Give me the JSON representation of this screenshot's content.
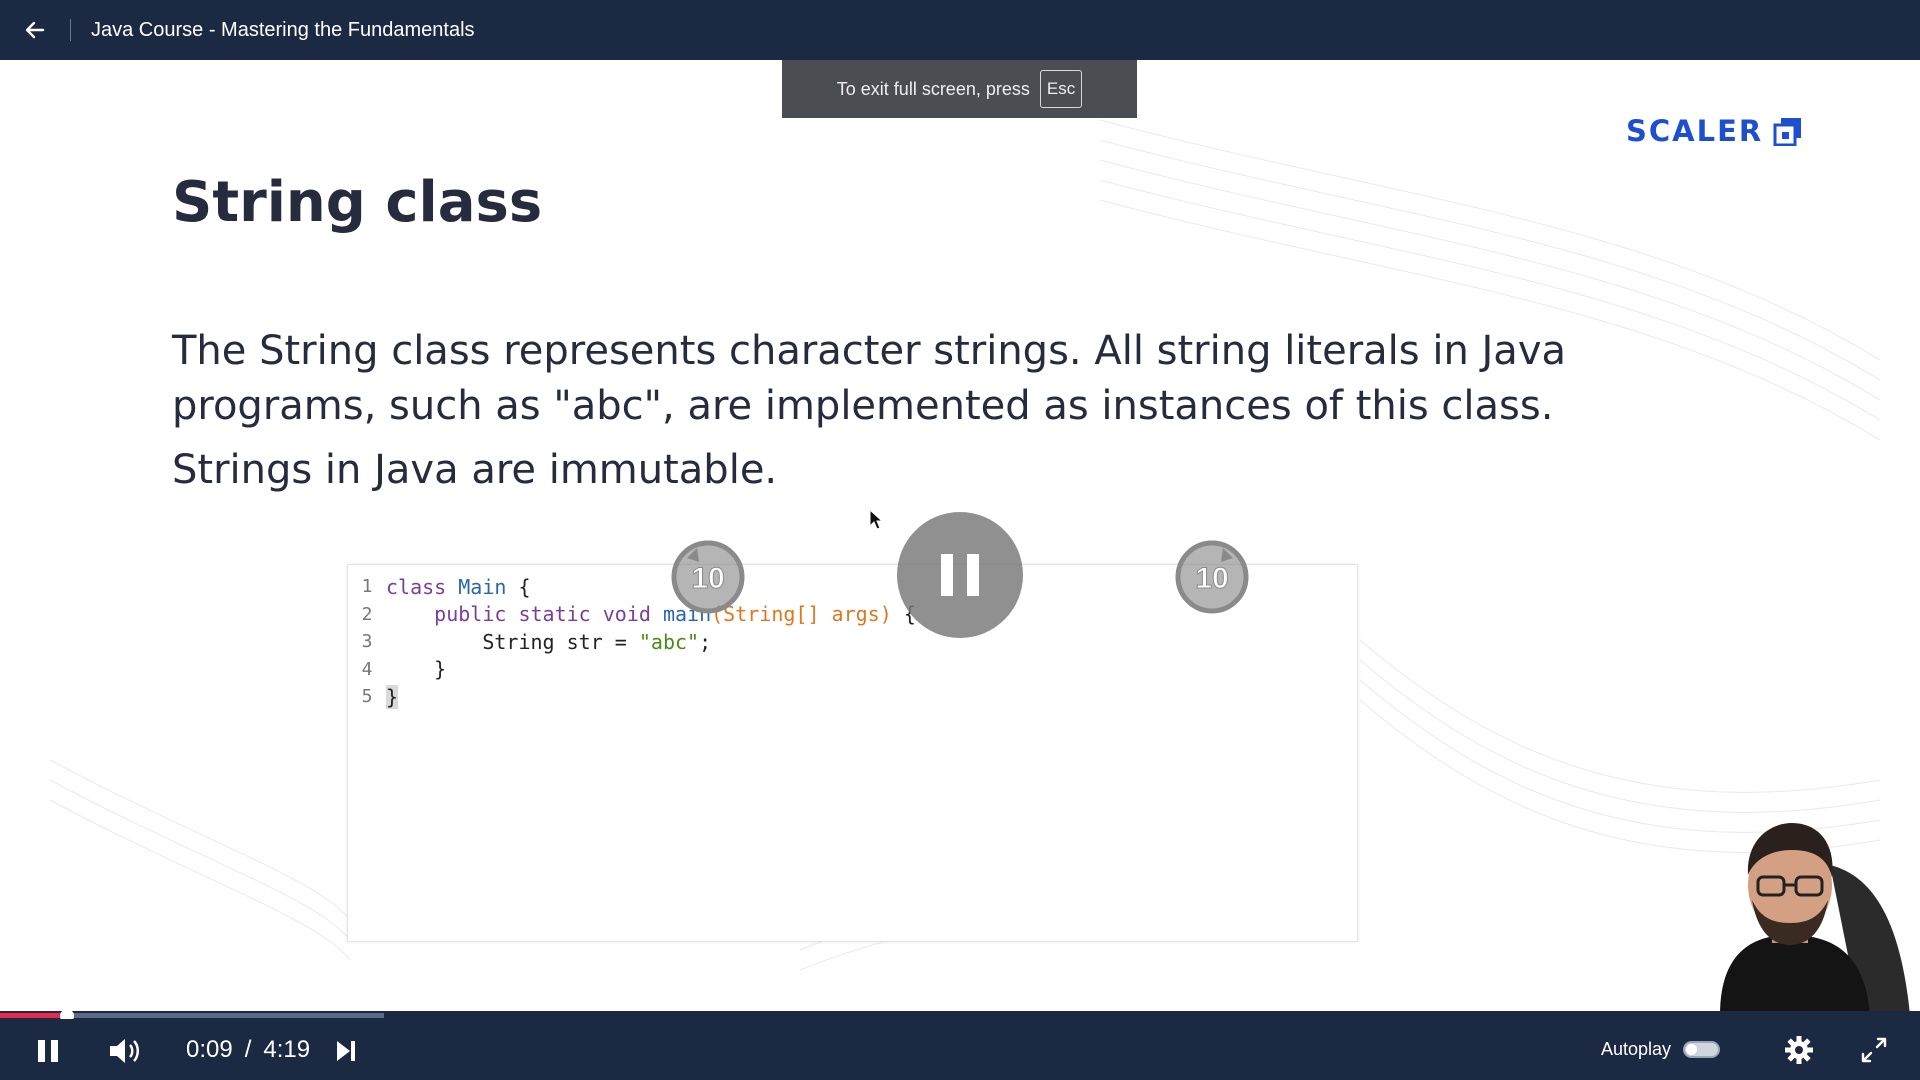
{
  "header": {
    "back_icon": "arrow-left-icon",
    "course_title": "Java Course - Mastering the Fundamentals"
  },
  "fullscreen_notice": {
    "text": "To exit full screen, press",
    "key": "Esc"
  },
  "slide": {
    "logo_text": "SCALER",
    "title": "String class",
    "paragraph": "The String class represents character strings. All string literals in Java programs, such as \"abc\", are implemented as instances of this class.",
    "paragraph2": "Strings in Java are immutable.",
    "code": {
      "line_numbers": [
        "1",
        "2",
        "3",
        "4",
        "5"
      ],
      "lines": [
        "class Main {",
        "    public static void main(String[] args) {",
        "        String str = \"abc\";",
        "    }",
        "}"
      ]
    }
  },
  "overlay": {
    "rewind_seconds": "10",
    "forward_seconds": "10"
  },
  "player": {
    "current_time": "0:09",
    "separator": "/",
    "duration": "4:19",
    "played_fraction": 0.035,
    "buffered_fraction": 0.2,
    "autoplay_label": "Autoplay",
    "autoplay_on": false
  },
  "colors": {
    "bar_bg": "#1c2943",
    "progress": "#e8294b",
    "brand": "#1e4fd0"
  }
}
